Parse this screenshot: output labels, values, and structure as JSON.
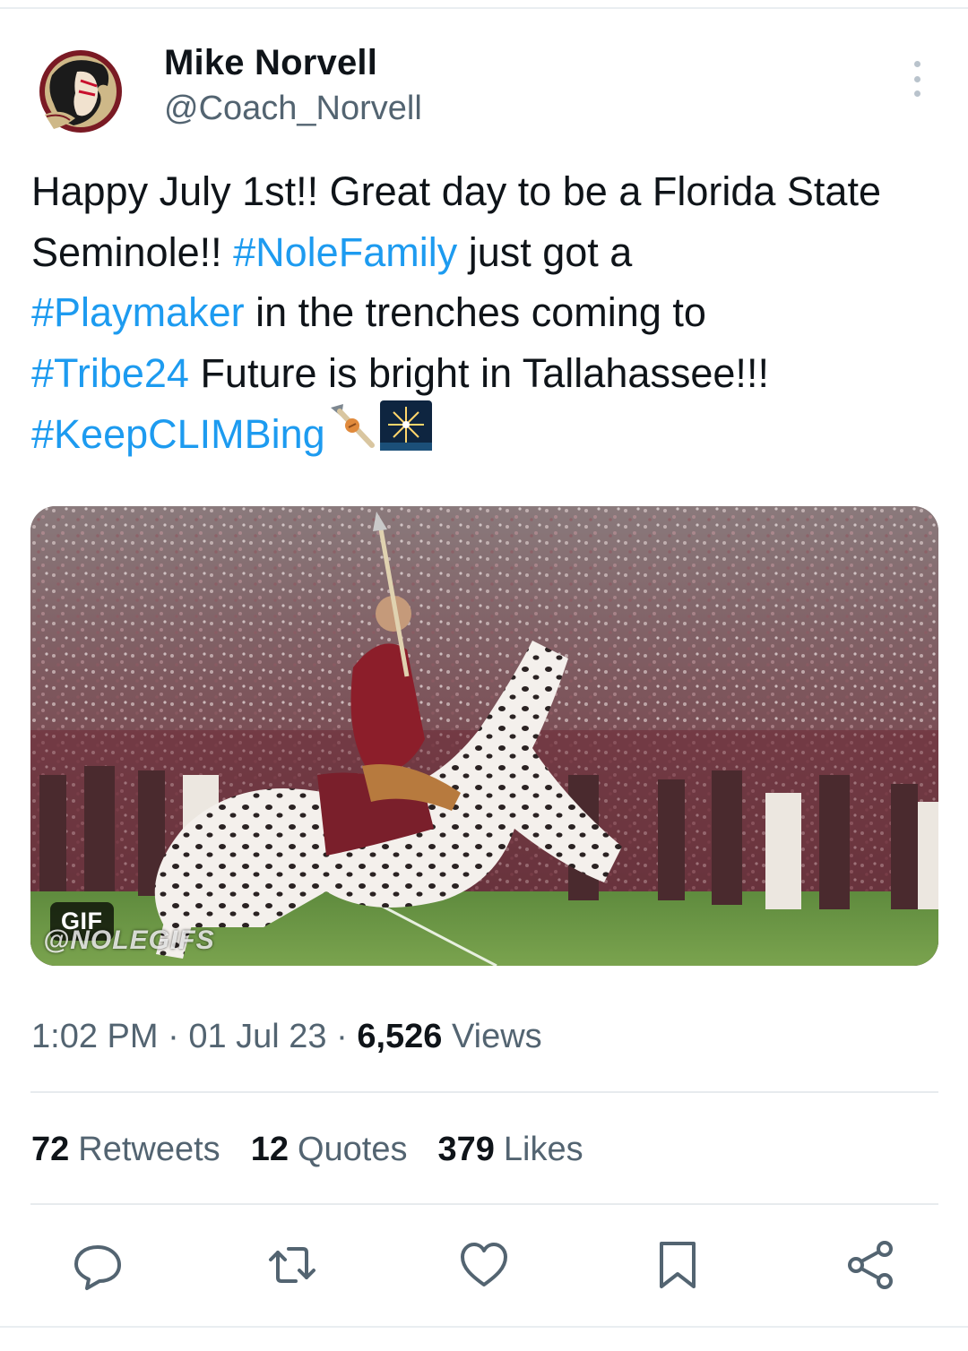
{
  "tweet": {
    "author_name": "Mike Norvell",
    "author_handle": "@Coach_Norvell",
    "avatar_icon": "seminole-logo-icon",
    "text_segments": [
      {
        "text": "Happy July 1st!! Great day to be a Florida State Seminole!! ",
        "type": "text"
      },
      {
        "text": "#NoleFamily",
        "type": "hashtag"
      },
      {
        "text": " just got a ",
        "type": "text"
      },
      {
        "text": "#Playmaker",
        "type": "hashtag"
      },
      {
        "text": " in the trenches coming to ",
        "type": "text"
      },
      {
        "text": "#Tribe24",
        "type": "hashtag"
      },
      {
        "text": " Future is bright in Tallahassee!!! ",
        "type": "text"
      },
      {
        "text": "#KeepCLIMBing",
        "type": "hashtag"
      }
    ],
    "emojis": [
      "spear-icon",
      "fireworks-icon"
    ],
    "media": {
      "badge": "GIF",
      "watermark": "@NOLEGIFS"
    },
    "time": "1:02 PM",
    "date": "01 Jul 23",
    "views_count": "6,526",
    "views_label": "Views",
    "retweets_count": "72",
    "retweets_label": "Retweets",
    "quotes_count": "12",
    "quotes_label": "Quotes",
    "likes_count": "379",
    "likes_label": "Likes"
  },
  "actions": [
    "reply-icon",
    "retweet-icon",
    "like-icon",
    "bookmark-icon",
    "share-icon"
  ],
  "colors": {
    "hashtag": "#1d9bf0",
    "secondary_text": "#536471",
    "primary_text": "#0f1419",
    "fsu_garnet": "#782f40",
    "fsu_gold": "#ceb888"
  }
}
